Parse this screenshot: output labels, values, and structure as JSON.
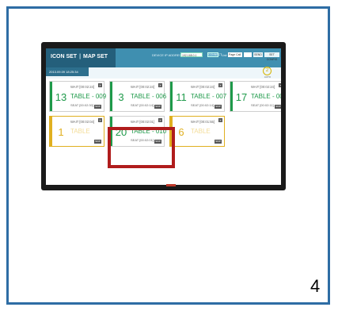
{
  "page_number": "4",
  "header": {
    "title": "ICON SET",
    "map_set": "MAP SET",
    "device_label": "DEVICE IP ADDRESS:",
    "device_value": "192.168.0.1",
    "connect": "CONNECT",
    "list_label": "List:",
    "list_value": "Page Call",
    "send": "SEND",
    "config": "SET CONFIG"
  },
  "datetime": "2013.09.09 18:25:34",
  "refresh": {
    "label": "AUTO",
    "glyph": "2"
  },
  "cards": [
    {
      "number": "13",
      "wait": "WAIT [00:02:24]",
      "table": "TABLE - 009",
      "seat": "SEAT [00:02:30]",
      "skip": "SKIP",
      "close": "X",
      "color": "#1e9a4a",
      "empty": false
    },
    {
      "number": "3",
      "wait": "WAIT [00:02:24]",
      "table": "TABLE - 006",
      "seat": "SEAT [00:02:14]",
      "skip": "SKIP",
      "close": "X",
      "color": "#1e9a4a",
      "empty": false
    },
    {
      "number": "11",
      "wait": "WAIT [00:02:24]",
      "table": "TABLE - 007",
      "seat": "SEAT [00:02:14]",
      "skip": "SKIP",
      "close": "X",
      "color": "#1e9a4a",
      "empty": false
    },
    {
      "number": "17",
      "wait": "WAIT [00:02:24]",
      "table": "TABLE - 008",
      "seat": "SEAT [00:02:11]",
      "skip": "SKIP",
      "close": "X",
      "color": "#1e9a4a",
      "empty": false
    },
    {
      "number": "1",
      "wait": "WAIT [00:02:04]",
      "table": "TABLE",
      "seat": "",
      "skip": "SKIP",
      "close": "X",
      "color": "#e0b020",
      "empty": true
    },
    {
      "number": "20",
      "wait": "WAIT [00:02:01]",
      "table": "TABLE - 010",
      "seat": "SEAT [00:02:01]",
      "skip": "SKIP",
      "close": "X",
      "color": "#1e9a4a",
      "empty": false
    },
    {
      "number": "6",
      "wait": "WAIT [00:01:55]",
      "table": "TABLE",
      "seat": "",
      "skip": "SKIP",
      "close": "X",
      "color": "#e0b020",
      "empty": true
    }
  ],
  "colors": {
    "header": "#3f8fb0",
    "highlight": "#b01c1c",
    "green": "#1e9a4a",
    "yellow": "#e0b020"
  }
}
